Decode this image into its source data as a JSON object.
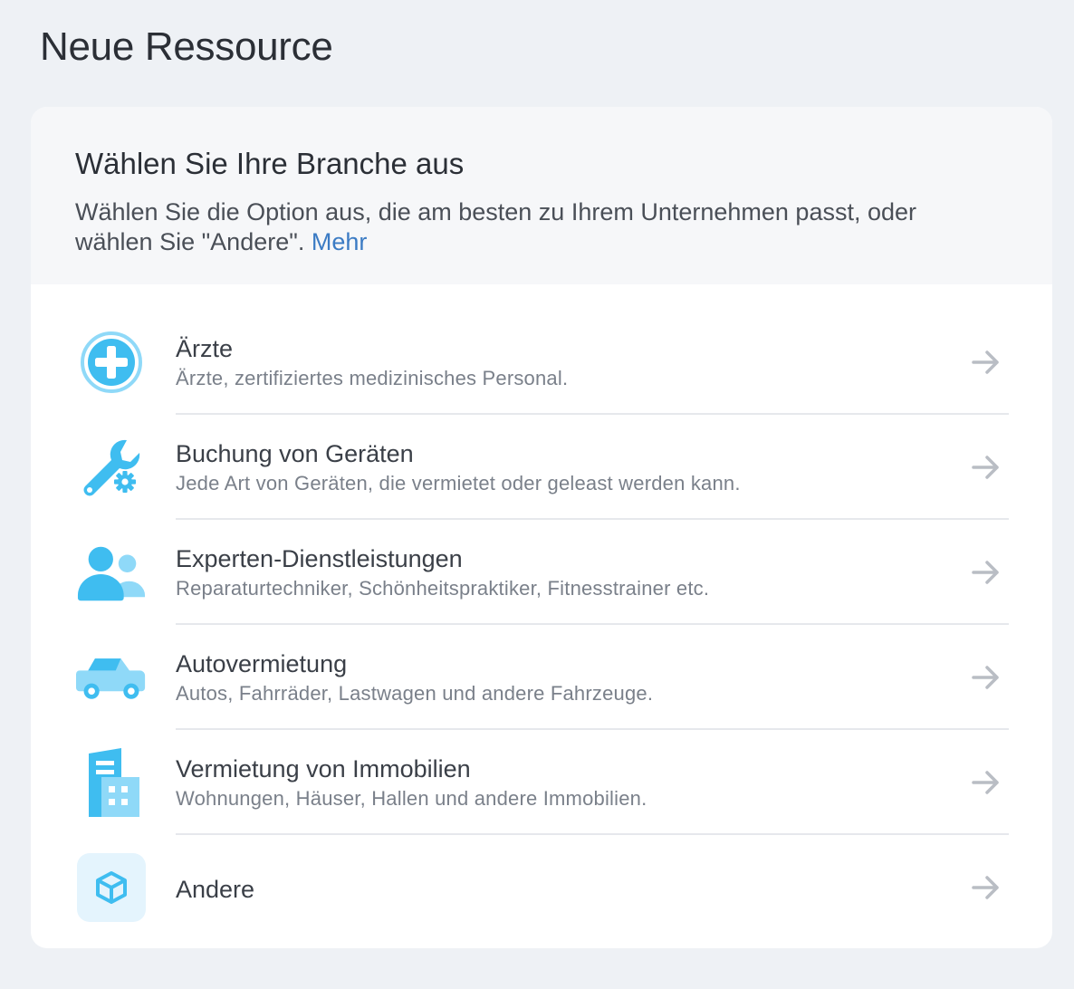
{
  "page": {
    "title": "Neue Ressource"
  },
  "card": {
    "title": "Wählen Sie Ihre Branche aus",
    "description": "Wählen Sie die Option aus, die am besten zu Ihrem Unternehmen passt, oder wählen Sie \"Andere\".",
    "more_link": "Mehr"
  },
  "options": [
    {
      "label": "Ärzte",
      "description": "Ärzte, zertifiziertes medizinisches Personal.",
      "icon": "medical-cross-icon"
    },
    {
      "label": "Buchung von Geräten",
      "description": "Jede Art von Geräten, die vermietet oder geleast werden kann.",
      "icon": "wrench-gear-icon"
    },
    {
      "label": "Experten-Dienstleistungen",
      "description": "Reparaturtechniker, Schönheitspraktiker, Fitnesstrainer etc.",
      "icon": "people-icon"
    },
    {
      "label": "Autovermietung",
      "description": "Autos, Fahrräder, Lastwagen und andere Fahrzeuge.",
      "icon": "car-icon"
    },
    {
      "label": "Vermietung von Immobilien",
      "description": "Wohnungen, Häuser, Hallen und andere Immobilien.",
      "icon": "building-icon"
    },
    {
      "label": "Andere",
      "description": "",
      "icon": "cube-icon"
    }
  ],
  "colors": {
    "accent": "#3fbdf0",
    "accent_light": "#8fd9f8",
    "link": "#3b7bc4",
    "arrow": "#b9bdc4"
  }
}
